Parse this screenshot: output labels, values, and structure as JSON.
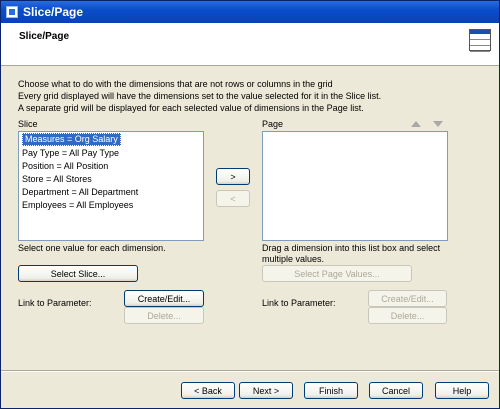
{
  "window": {
    "title": "Slice/Page"
  },
  "header": {
    "title": "Slice/Page",
    "icon": "grid-layout-icon"
  },
  "description": {
    "line1": "Choose what to do with the dimensions that are not rows or columns in the grid",
    "line2": "Every grid displayed will have the dimensions set to the value selected for it in the Slice list.",
    "line3": "A separate grid will be displayed for each selected value of dimensions in the Page list."
  },
  "slice": {
    "label": "Slice",
    "items": [
      "Measures = Org Salary",
      "Pay Type = All Pay Type",
      "Position = All Position",
      "Store = All Stores",
      "Department = All Department",
      "Employees = All Employees"
    ],
    "hint": "Select one value for each dimension.",
    "select_button": "Select Slice...",
    "link_label": "Link to Parameter:",
    "create_button": "Create/Edit...",
    "delete_button": "Delete..."
  },
  "move": {
    "right": ">",
    "left": "<"
  },
  "page": {
    "label": "Page",
    "hint_line1": "Drag a dimension into this list box and select",
    "hint_line2": "multiple values.",
    "select_button": "Select Page Values...",
    "link_label": "Link to Parameter:",
    "create_button": "Create/Edit...",
    "delete_button": "Delete..."
  },
  "footer": {
    "back": "< Back",
    "next": "Next >",
    "finish": "Finish",
    "cancel": "Cancel",
    "help": "Help"
  }
}
